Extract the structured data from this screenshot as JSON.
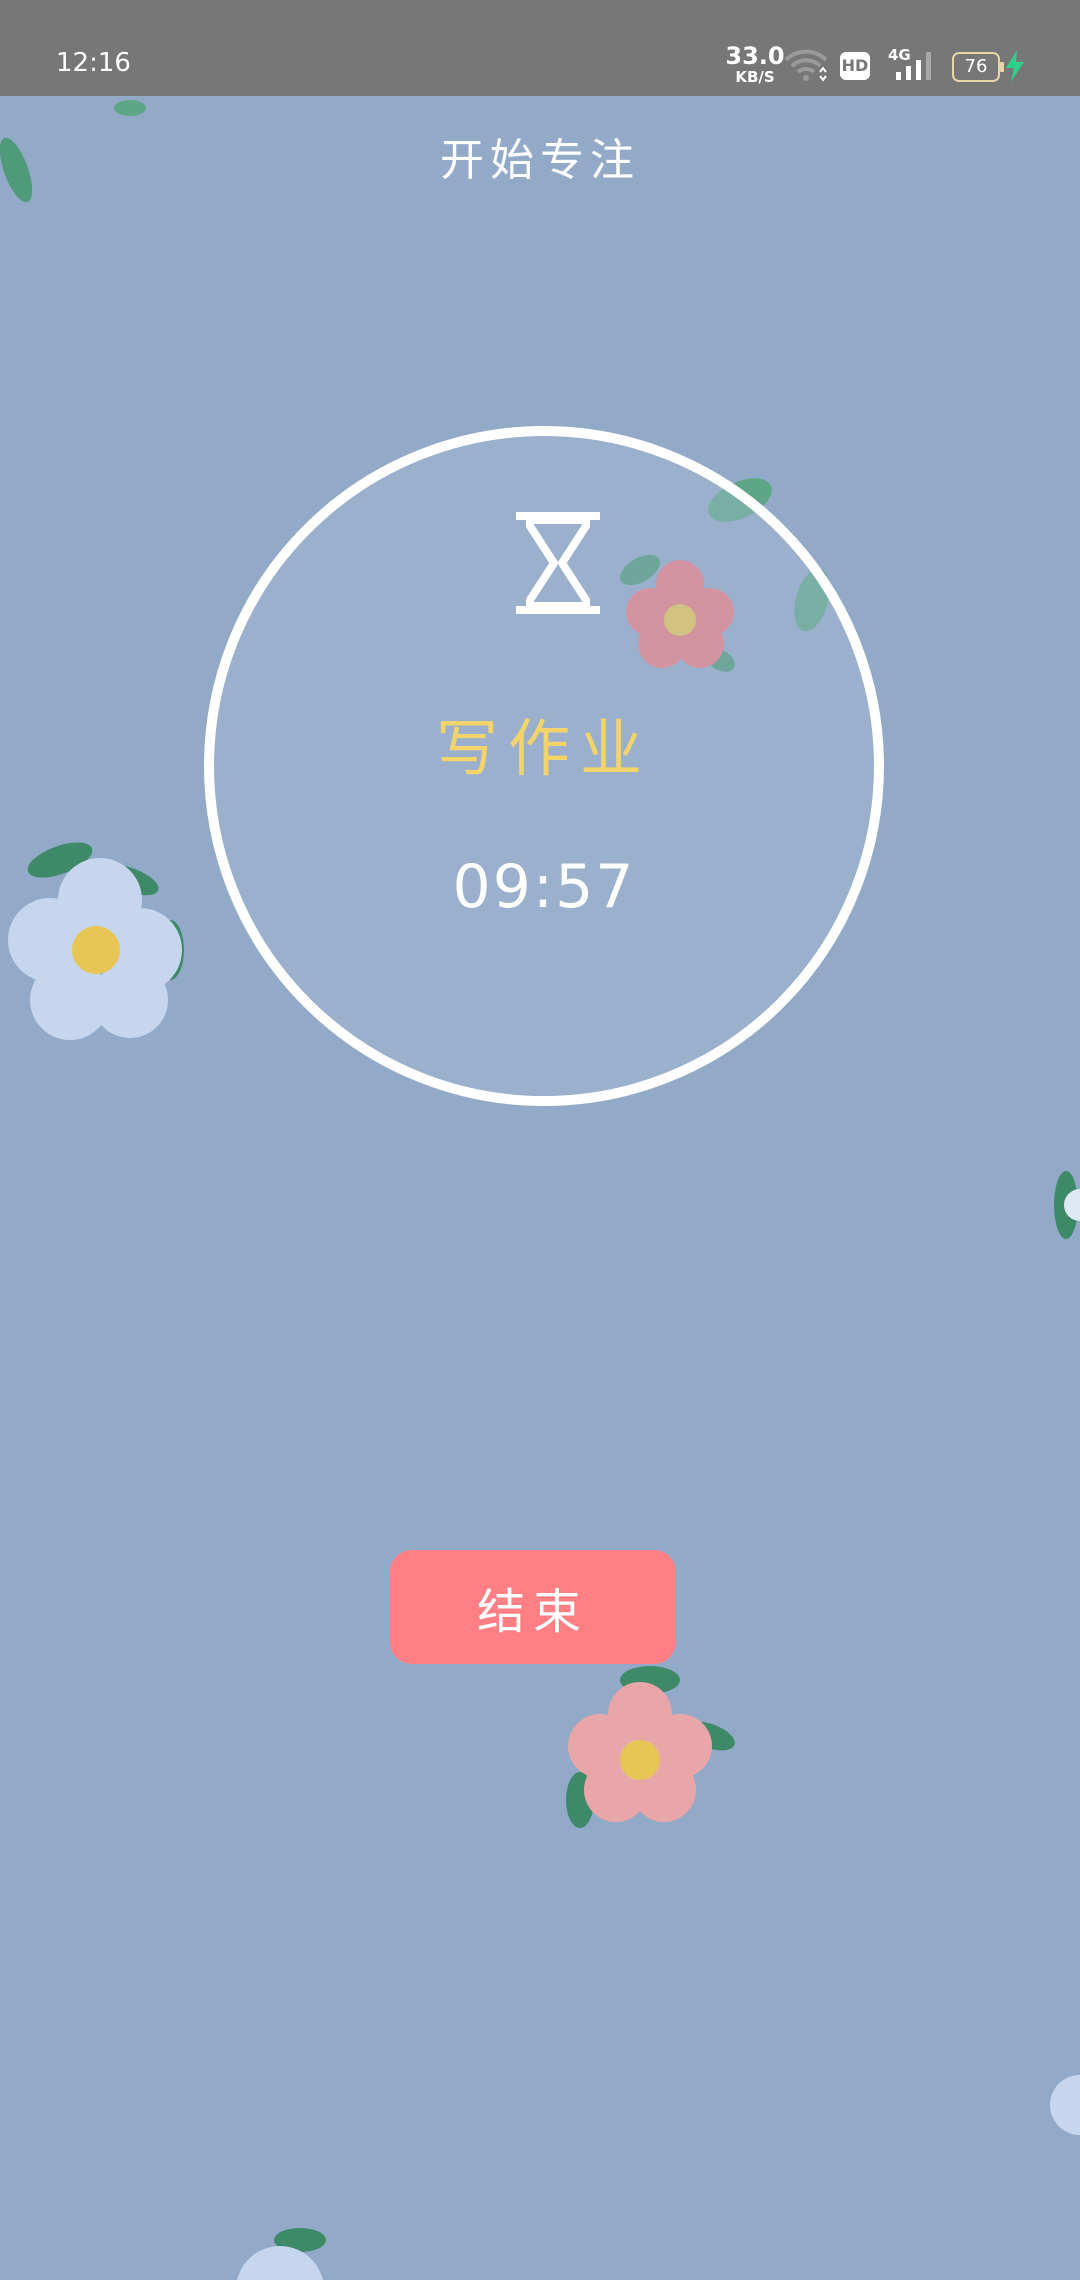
{
  "status_bar": {
    "time": "12:16",
    "network_speed": "33.0",
    "network_speed_unit": "KB/S",
    "hd_label": "HD",
    "network_type": "4G",
    "battery_level": "76"
  },
  "header": {
    "title": "开始专注"
  },
  "timer": {
    "icon": "hourglass-icon",
    "task_name": "写作业",
    "remaining": "09:57"
  },
  "actions": {
    "end_label": "结束"
  },
  "colors": {
    "background": "#92aac8",
    "status_bar": "#777777",
    "task_text": "#f3d46a",
    "end_button": "#ff7f85"
  }
}
